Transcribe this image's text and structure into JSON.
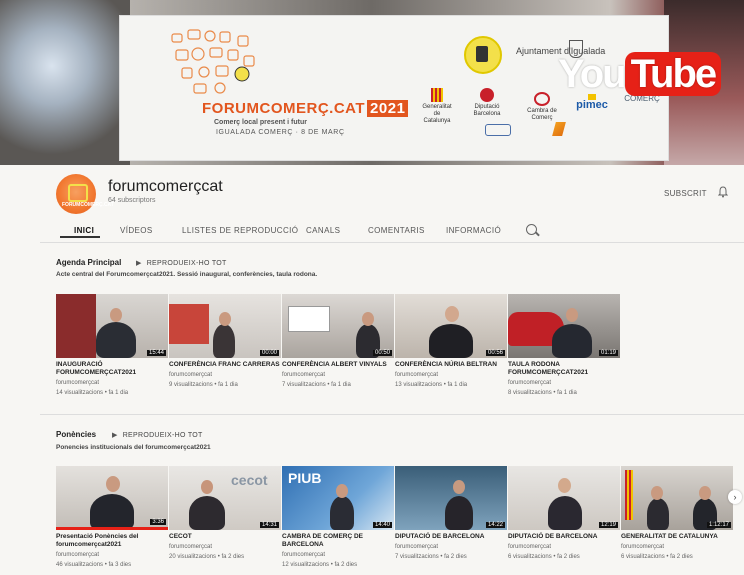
{
  "banner": {
    "brand_name": "FORUMCOMERÇ.CAT",
    "brand_year": "2021",
    "brand_sub": "Comerç local present i futur",
    "brand_date": "IGUALADA COMERÇ · 8 DE MARÇ",
    "ajuntament": "Ajuntament d'Igualada",
    "logos": [
      "Generalitat de Catalunya",
      "Diputació Barcelona",
      "Cambra de Comerç",
      "pimec",
      "cecot COMERÇ"
    ],
    "youtube": {
      "you": "You",
      "tube": "Tube"
    }
  },
  "channel": {
    "name": "forumcomerçcat",
    "subscribers": "64 subscriptors",
    "subscribe_label": "SUBSCRIT",
    "avatar_text": "FORUMCOMERÇ.CAT"
  },
  "tabs": [
    "INICI",
    "VÍDEOS",
    "LLISTES DE REPRODUCCIÓ",
    "CANALS",
    "COMENTARIS",
    "INFORMACIÓ"
  ],
  "sections": [
    {
      "title": "Agenda Principal",
      "play_all": "REPRODUEIX-HO TOT",
      "description": "Acte central del Forumcomerçcat2021. Sessió inaugural, conferències, taula rodona.",
      "videos": [
        {
          "title": "INAUGURACIÓ FORUMCOMERÇCAT2021",
          "channel": "forumcomerçcat",
          "meta": "14 visualitzacions • fa 1 dia",
          "duration": "15:44"
        },
        {
          "title": "CONFERÈNCIA FRANC CARRERAS",
          "channel": "forumcomerçcat",
          "meta": "9 visualitzacions • fa 1 dia",
          "duration": "00:00"
        },
        {
          "title": "CONFERÈNCIA ALBERT VINYALS",
          "channel": "forumcomerçcat",
          "meta": "7 visualitzacions • fa 1 dia",
          "duration": "00:50"
        },
        {
          "title": "CONFERÈNCIA NÚRIA BELTRAN",
          "channel": "forumcomerçcat",
          "meta": "13 visualitzacions • fa 1 dia",
          "duration": "00:56"
        },
        {
          "title": "TAULA RODONA FORUMCOMERÇCAT2021",
          "channel": "forumcomerçcat",
          "meta": "8 visualitzacions • fa 1 dia",
          "duration": "01:19"
        }
      ]
    },
    {
      "title": "Ponències",
      "play_all": "REPRODUEIX-HO TOT",
      "description": "Ponencies institucionals del forumcomerçcat2021",
      "videos": [
        {
          "title": "Presentació Ponències del forumcomerçcat2021",
          "channel": "forumcomerçcat",
          "meta": "46 visualitzacions • fa 3 dies",
          "duration": "3:36"
        },
        {
          "title": "CECOT",
          "channel": "forumcomerçcat",
          "meta": "20 visualitzacions • fa 2 dies",
          "duration": "14:31"
        },
        {
          "title": "CAMBRA DE COMERÇ DE BARCELONA",
          "channel": "forumcomerçcat",
          "meta": "12 visualitzacions • fa 2 dies",
          "duration": "14:40"
        },
        {
          "title": "DIPUTACIÓ DE BARCELONA",
          "channel": "forumcomerçcat",
          "meta": "7 visualitzacions • fa 2 dies",
          "duration": "14:22"
        },
        {
          "title": "DIPUTACIÓ DE BARCELONA",
          "channel": "forumcomerçcat",
          "meta": "6 visualitzacions • fa 2 dies",
          "duration": "12:19"
        },
        {
          "title": "GENERALITAT DE CATALUNYA",
          "channel": "forumcomerçcat",
          "meta": "6 visualitzacions • fa 2 dies",
          "duration": "1:12:17"
        }
      ]
    }
  ]
}
